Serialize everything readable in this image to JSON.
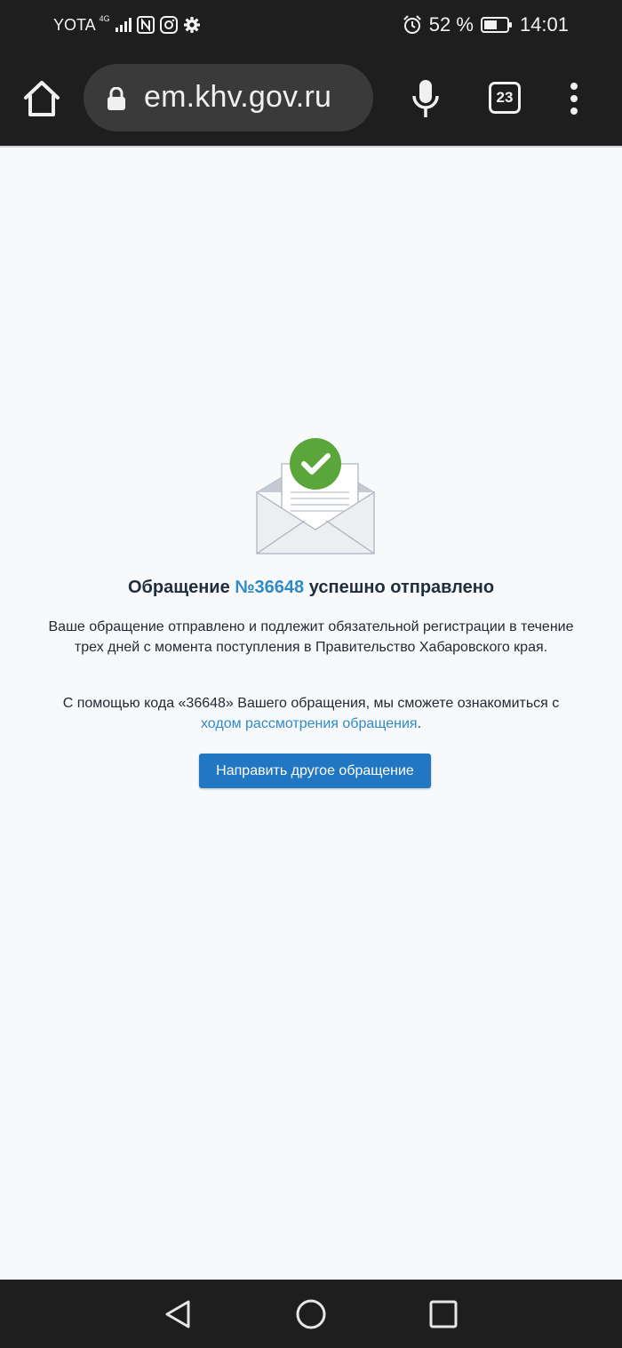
{
  "status_bar": {
    "carrier": "YOTA",
    "network_type": "4G",
    "battery_percent": "52 %",
    "time": "14:01",
    "icons": [
      "signal-icon",
      "nfc-icon",
      "instagram-icon",
      "settings-gear-icon",
      "alarm-icon",
      "battery-icon"
    ]
  },
  "browser": {
    "url": "em.khv.gov.ru",
    "tab_count": "23",
    "icons": [
      "home-icon",
      "lock-icon",
      "mic-icon",
      "more-vert-icon"
    ]
  },
  "page": {
    "title_prefix": "Обращение ",
    "title_number": "№36648",
    "title_suffix": " успешно отправлено",
    "paragraph1": "Ваше обращение отправлено и подлежит обязательной регистрации в течение трех дней с момента поступления в Правительство Хабаровского края.",
    "paragraph2_prefix": "С помощью кода «36648» Вашего обращения, мы сможете ознакомиться с ",
    "paragraph2_link": "ходом рассмотрения обращения",
    "paragraph2_suffix": ".",
    "button_label": "Направить другое обращение",
    "colors": {
      "accent_link": "#2f8ac8",
      "button": "#2177c1",
      "success": "#5aa63a"
    }
  },
  "nav_bar": {
    "icons": [
      "back-triangle-icon",
      "home-circle-icon",
      "recent-square-icon"
    ]
  }
}
